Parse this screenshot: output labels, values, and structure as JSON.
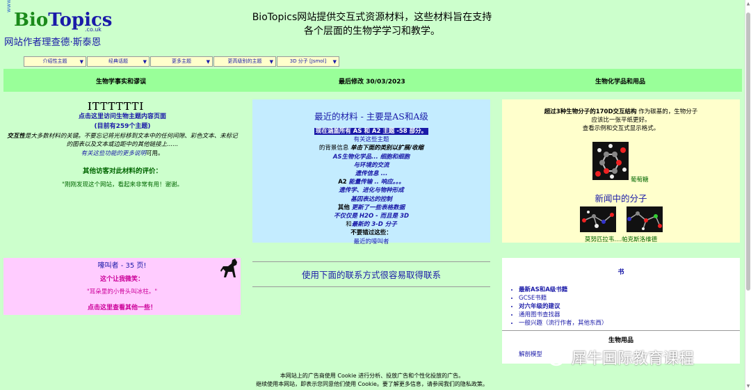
{
  "header": {
    "logo_www": "www.",
    "logo_bio": "Bio",
    "logo_topics": "Topics",
    "logo_couk": ".co.uk",
    "author": "网站作者理查德·斯泰恩",
    "intro": "BioTopics网站提供交互式资源材料，这些材料旨在支持各个层面的生物学学习和教学。"
  },
  "nav": [
    {
      "label": "介绍性主题"
    },
    {
      "label": "经典话题"
    },
    {
      "label": "更多主题"
    },
    {
      "label": "更高级别的主题"
    },
    {
      "label": "3D 分子 [Jsmol]"
    }
  ],
  "band": {
    "left": "生物学事实和谬误",
    "middle": "最后修改 30/03/2023",
    "right": "生物化学品和用品"
  },
  "left": {
    "ttt": "ITTTTTTI",
    "link1": "点击这里访问生物主题内容页面",
    "link2": "(目前有259个主题)",
    "desc_bold": "交互性",
    "desc": "是大多数材料的关键。不要忘记将光标移到文本中的任何间隙、彩色文本、未标记的图表以及文本或边距中的其他链接上......",
    "more": "有关这些功能的更多说明",
    "more_tail": "可用。",
    "comment_title": "其他访客对此材料的评价：",
    "comment": "\"刚刚发现这个网站，看起来非常有用！谢谢。"
  },
  "blue_panel": {
    "title": "最近的材料 - 主要是AS和A级",
    "highlight": "现在涵盖所有 AS 和 A2 主题 -58 部分。",
    "about": "有关这些主题",
    "bg_prefix": "的背景信息",
    "bg_bold": "单击下面的类别以扩展/收缩",
    "l1": "AS生物化学品... 细胞和细胞",
    "l2": "与环境的交流",
    "l3": "遗传信息 ...",
    "a2_prefix": "A2",
    "l4": "能量传输 .. 响应。。。",
    "l5": "遗传学、进化与物种形成",
    "l6": "基因表达的控制",
    "other_prefix": "其他",
    "l7": "更新了一些表格数据",
    "l8": "不仅仅是 H2O - 而且是 3D",
    "and_prefix": "和",
    "l9": "最新的 3-D 分子",
    "dontmiss": "不要错过这些：",
    "l10": "最近的嚎叫者"
  },
  "yellow_panel": {
    "line1_bold": "超过3种生物分子的170D交互结构",
    "line1_rest": "作为碳基的，生物分子",
    "line2": "应该比一张平纸更好。",
    "line3": "查看示例和交互式显示格式。",
    "glucose": "葡萄糖",
    "news_title": "新闻中的分子",
    "mol1": "莫努匹拉韦",
    "mol_dots": "....",
    "mol2": "帕克斯洛维德"
  },
  "pink_panel": {
    "title": "嚎叫者 - 35 页!",
    "line2": "这个让我微笑：",
    "quote": "\"耳朵里的小骨头叫冰柱。\"",
    "link": "点击这里查看其他一些！"
  },
  "contact": {
    "text": "使用下面的联系方式很容易取得联系"
  },
  "books": {
    "title": "书",
    "items": [
      "最新AS和A级书籍",
      "GCSE书籍",
      "对六年级的建议",
      "通用图书查找器",
      "一般兴趣（流行作者，其他东西）"
    ],
    "supplies_title": "生物用品",
    "supplies_link": "解剖模型"
  },
  "cookie": {
    "line1": "本网站上的广告商使用 Cookie 进行分析、投放广告和个性化投放的广告。",
    "line2": "继续使用本网站，即表示您同意他们使用 Cookie。要了解更多信息，请参阅我们的隐私政策。"
  },
  "watermark": {
    "text": "犀牛国际教育课程"
  },
  "colors": {
    "background": "#ccffcc",
    "band": "#99ff99",
    "blue_panel": "#c4ecff",
    "yellow_panel": "#ffffcc",
    "pink_panel": "#ffccff",
    "link": "#1a1aa8"
  }
}
